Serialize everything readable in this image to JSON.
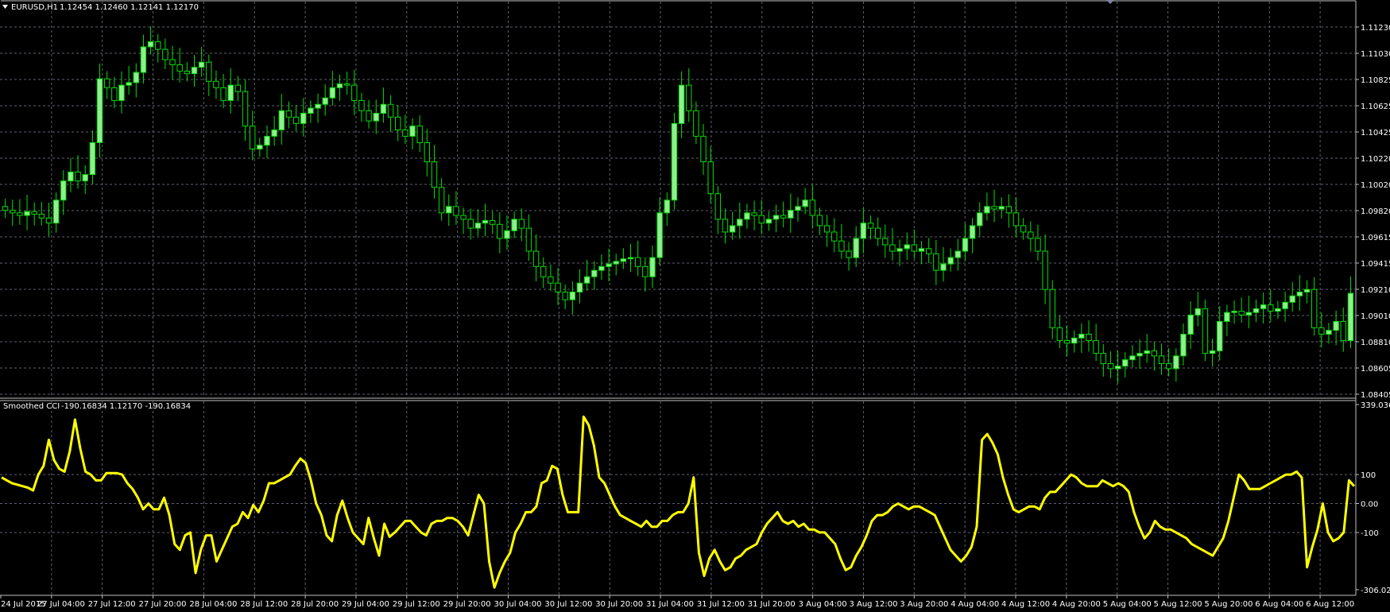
{
  "window": {
    "main_title": "EURUSD,H1",
    "ohlc": "1.12454 1.12460 1.12141 1.12170",
    "indicator_title": "Smoothed CCI",
    "indicator_values": "-190.16834 1.12170 -190.16834"
  },
  "colors": {
    "background": "#000000",
    "grid": "#606070",
    "axis_line": "#c0c0c0",
    "text": "#ffffff",
    "bull_candle": "#90ee90",
    "bear_candle": "#000000",
    "wick": "#00e000",
    "cci_line": "#ffff00"
  },
  "chart_data": [
    {
      "type": "candlestick",
      "title": "EURUSD,H1",
      "y_tick_labels": [
        "1.11230",
        "1.11030",
        "1.10825",
        "1.10625",
        "1.10425",
        "1.10220",
        "1.10020",
        "1.09820",
        "1.09615",
        "1.09415",
        "1.09210",
        "1.09010",
        "1.08810",
        "1.08605",
        "1.08405"
      ],
      "ylim": [
        1.0838,
        1.1133
      ],
      "grid": true,
      "close_values": [
        1.0982,
        1.098,
        1.0978,
        1.0981,
        1.0979,
        1.0976,
        1.0972,
        1.099,
        1.1005,
        1.1012,
        1.1005,
        1.101,
        1.1035,
        1.1085,
        1.1078,
        1.1068,
        1.108,
        1.1082,
        1.109,
        1.111,
        1.1114,
        1.1108,
        1.11,
        1.1096,
        1.1091,
        1.1089,
        1.1094,
        1.1098,
        1.1083,
        1.1078,
        1.1068,
        1.108,
        1.1075,
        1.1048,
        1.103,
        1.1033,
        1.104,
        1.1045,
        1.106,
        1.1055,
        1.105,
        1.1058,
        1.1062,
        1.1065,
        1.107,
        1.1078,
        1.1081,
        1.108,
        1.1068,
        1.106,
        1.1052,
        1.1058,
        1.1065,
        1.1055,
        1.1045,
        1.104,
        1.1048,
        1.1035,
        1.102,
        1.1,
        1.098,
        1.0985,
        1.0978,
        1.0975,
        1.0968,
        1.0972,
        1.0974,
        1.0971,
        1.096,
        1.0966,
        1.0975,
        1.0968,
        1.095,
        1.0938,
        1.093,
        1.0925,
        1.0918,
        1.0912,
        1.0918,
        1.0925,
        1.093,
        1.0935,
        1.0938,
        1.094,
        1.0942,
        1.0944,
        1.0945,
        1.0938,
        1.093,
        1.0945,
        1.098,
        1.099,
        1.105,
        1.108,
        1.106,
        1.104,
        1.102,
        1.0995,
        1.0975,
        1.0965,
        1.097,
        1.0975,
        1.098,
        1.0978,
        1.0972,
        1.0975,
        1.0978,
        1.0976,
        1.0982,
        1.0985,
        1.099,
        1.0978,
        1.097,
        1.0965,
        1.0958,
        1.095,
        1.0945,
        1.096,
        1.0972,
        1.0968,
        1.096,
        1.0955,
        1.095,
        1.0952,
        1.0955,
        1.095,
        1.0952,
        1.0948,
        1.0935,
        1.094,
        1.0945,
        1.095,
        1.096,
        1.097,
        1.098,
        1.0985,
        1.0983,
        1.0985,
        1.098,
        1.097,
        1.0965,
        1.096,
        1.095,
        1.092,
        1.089,
        1.088,
        1.0878,
        1.0882,
        1.0885,
        1.088,
        1.087,
        1.0862,
        1.0858,
        1.086,
        1.0865,
        1.0868,
        1.087,
        1.0872,
        1.0868,
        1.0862,
        1.0858,
        1.0868,
        1.0885,
        1.09,
        1.0905,
        1.087,
        1.0872,
        1.0895,
        1.0902,
        1.0903,
        1.09,
        1.0902,
        1.0905,
        1.0908,
        1.0903,
        1.0905,
        1.091,
        1.0915,
        1.0918,
        1.092,
        1.089,
        1.0885,
        1.0888,
        1.0895,
        1.088,
        1.0917
      ]
    },
    {
      "type": "line",
      "title": "Smoothed CCI",
      "series": [
        {
          "name": "Smoothed CCI",
          "color": "#ffff00"
        }
      ],
      "y_tick_labels": [
        "339.0364",
        "100",
        "0.00",
        "-100",
        "-306.0281"
      ],
      "ylim": [
        -306.0281,
        339.0364
      ],
      "grid": true,
      "values": [
        90,
        80,
        70,
        65,
        60,
        55,
        45,
        100,
        130,
        220,
        150,
        120,
        110,
        180,
        290,
        190,
        110,
        100,
        80,
        80,
        105,
        105,
        105,
        100,
        70,
        50,
        20,
        -20,
        0,
        -20,
        -20,
        20,
        -40,
        -140,
        -160,
        -110,
        -100,
        -240,
        -160,
        -110,
        -110,
        -200,
        -160,
        -120,
        -80,
        -70,
        -30,
        -50,
        -5,
        -30,
        10,
        70,
        70,
        80,
        90,
        100,
        130,
        155,
        140,
        80,
        0,
        -40,
        -110,
        -130,
        -40,
        10,
        -50,
        -100,
        -120,
        -140,
        -50,
        -120,
        -180,
        -70,
        -115,
        -100,
        -80,
        -60,
        -60,
        -80,
        -100,
        -110,
        -70,
        -60,
        -60,
        -50,
        -50,
        -60,
        -80,
        -110,
        -40,
        30,
        0,
        -200,
        -290,
        -240,
        -200,
        -170,
        -100,
        -70,
        -30,
        -30,
        -10,
        70,
        80,
        130,
        120,
        30,
        -30,
        -30,
        -30,
        300,
        270,
        200,
        90,
        70,
        30,
        -10,
        -40,
        -50,
        -60,
        -70,
        -80,
        -60,
        -80,
        -80,
        -60,
        -60,
        -40,
        -30,
        -30,
        0,
        90,
        -170,
        -250,
        -190,
        -160,
        -200,
        -230,
        -220,
        -190,
        -180,
        -160,
        -150,
        -140,
        -100,
        -70,
        -50,
        -30,
        -60,
        -70,
        -60,
        -80,
        -70,
        -90,
        -90,
        -100,
        -100,
        -120,
        -140,
        -190,
        -230,
        -220,
        -180,
        -150,
        -110,
        -60,
        -40,
        -40,
        -30,
        -10,
        0,
        -10,
        -20,
        -10,
        -10,
        -20,
        -30,
        -40,
        -80,
        -120,
        -160,
        -180,
        -200,
        -180,
        -150,
        -80,
        220,
        240,
        210,
        170,
        90,
        30,
        -20,
        -30,
        -20,
        -10,
        -10,
        -20,
        20,
        40,
        40,
        60,
        80,
        100,
        90,
        70,
        60,
        60,
        60,
        80,
        70,
        60,
        70,
        60,
        40,
        -30,
        -80,
        -120,
        -100,
        -60,
        -80,
        -90,
        -90,
        -100,
        -110,
        -120,
        -140,
        -150,
        -160,
        -170,
        -180,
        -150,
        -120,
        -60,
        20,
        100,
        80,
        50,
        50,
        50,
        60,
        70,
        80,
        90,
        100,
        100,
        110,
        90,
        -220,
        -150,
        -90,
        0,
        -100,
        -130,
        -120,
        -100,
        80,
        60
      ]
    }
  ],
  "x_tick_labels": [
    "24 Jul 2015",
    "27 Jul 04:00",
    "27 Jul 12:00",
    "27 Jul 20:00",
    "28 Jul 04:00",
    "28 Jul 12:00",
    "28 Jul 20:00",
    "29 Jul 04:00",
    "29 Jul 12:00",
    "29 Jul 20:00",
    "30 Jul 04:00",
    "30 Jul 12:00",
    "30 Jul 20:00",
    "31 Jul 04:00",
    "31 Jul 12:00",
    "31 Jul 20:00",
    "3 Aug 04:00",
    "3 Aug 12:00",
    "3 Aug 20:00",
    "4 Aug 04:00",
    "4 Aug 12:00",
    "4 Aug 20:00",
    "5 Aug 04:00",
    "5 Aug 12:00",
    "5 Aug 20:00",
    "6 Aug 04:00",
    "6 Aug 12:00"
  ]
}
